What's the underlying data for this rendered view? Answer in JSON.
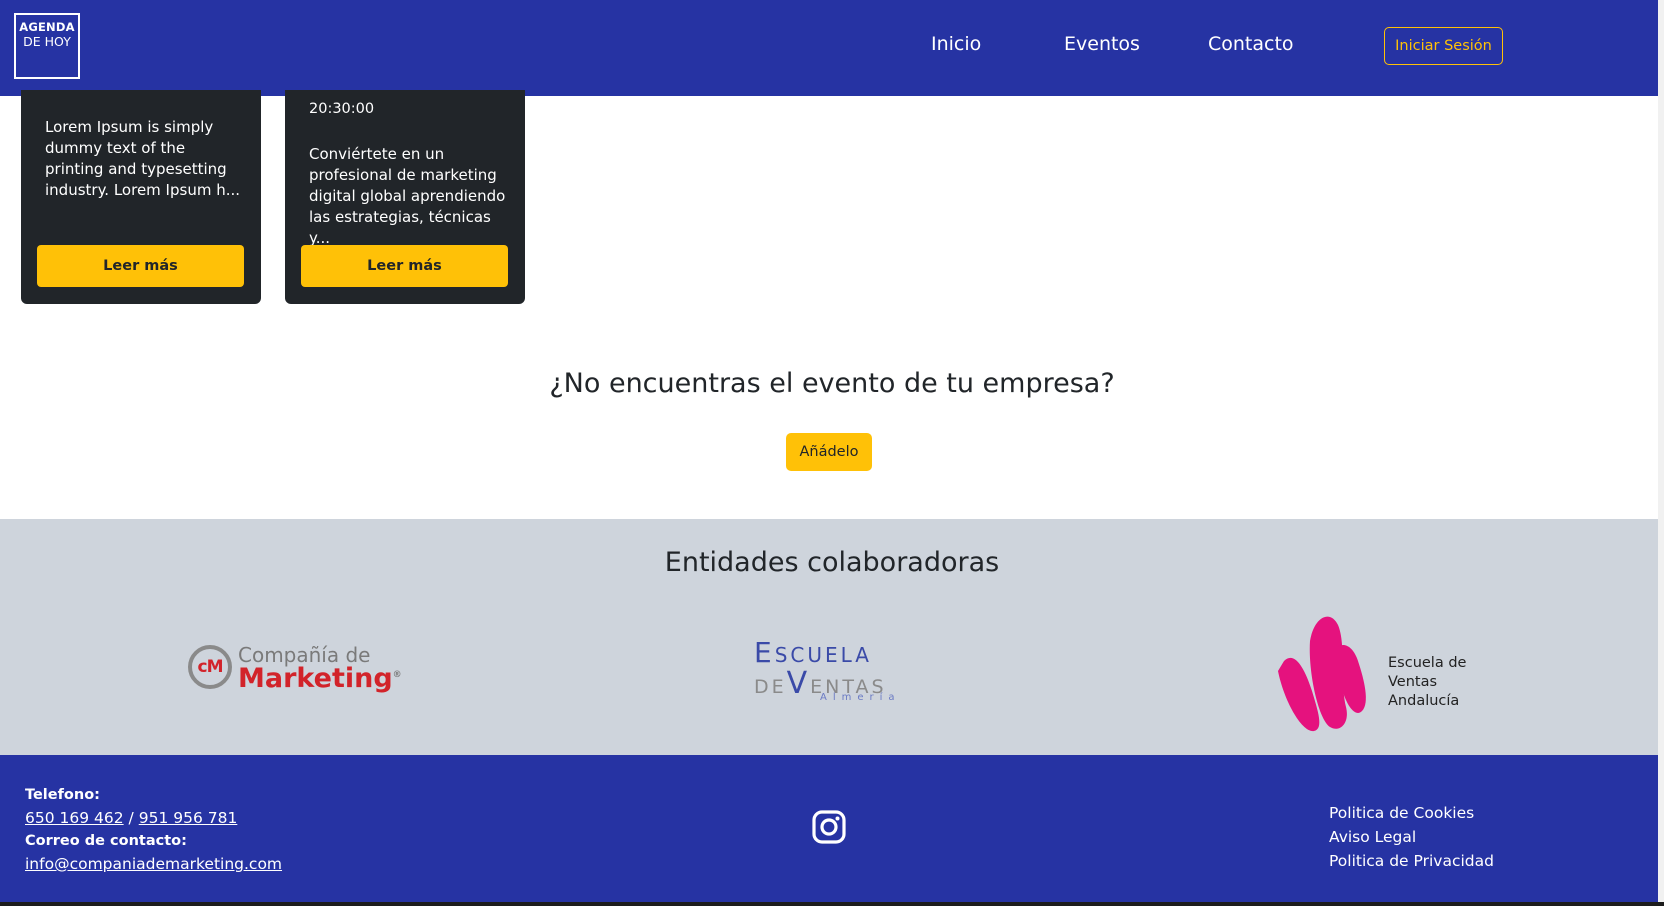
{
  "brand": {
    "line1": "AGENDA",
    "line2": "DE HOY"
  },
  "nav": {
    "inicio": "Inicio",
    "eventos": "Eventos",
    "contacto": "Contacto",
    "login": "Iniciar Sesión"
  },
  "cards": [
    {
      "time": "",
      "text": "Lorem Ipsum is simply dummy text of the printing and typesetting industry. Lorem Ipsum h...",
      "button": "Leer más"
    },
    {
      "time": "20:30:00",
      "text": "Conviértete en un profesional de marketing digital global aprendiendo las estrategias, técnicas y...",
      "button": "Leer más"
    }
  ],
  "cta": {
    "title": "¿No encuentras el evento de tu empresa?",
    "button": "Añádelo"
  },
  "partners": {
    "title": "Entidades colaboradoras",
    "p1": {
      "mark": "cM",
      "line1": "Compañía de",
      "line2": "Marketing",
      "reg": "®"
    },
    "p2": {
      "a_cap": "E",
      "a_rest": "SCUELA",
      "b1": "DE",
      "b_cap": "V",
      "b2": "ENTAS",
      "c": "Almería"
    },
    "p3": {
      "line1": "Escuela de",
      "line2": "Ventas",
      "line3": "Andalucía",
      "color": "#e5127e"
    }
  },
  "footer": {
    "phone_label": "Telefono:",
    "phone1": "650 169 462",
    "separator": "/",
    "phone2": "951 956 781",
    "email_label": "Correo de contacto:",
    "email": "info@companiademarketing.com",
    "social_icon": "instagram-icon",
    "links": [
      "Politica de Cookies",
      "Aviso Legal",
      "Politica de Privacidad"
    ]
  },
  "colors": {
    "nav_bg": "#2633a3",
    "accent": "#ffc107",
    "card_bg": "#212529",
    "partners_bg": "#ced4dc"
  }
}
